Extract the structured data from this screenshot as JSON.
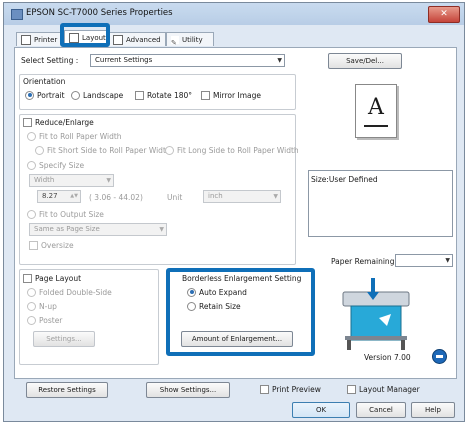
{
  "window": {
    "title": "EPSON SC-T7000 Series Properties",
    "close": "✕"
  },
  "tabs": [
    {
      "label": "Printer Setting"
    },
    {
      "label": "Layout"
    },
    {
      "label": "Advanced"
    },
    {
      "label": "Utility"
    }
  ],
  "select_setting": {
    "label": "Select Setting :",
    "value": "Current Settings",
    "save_del": "Save/Del..."
  },
  "orientation": {
    "label": "Orientation",
    "portrait": "Portrait",
    "landscape": "Landscape",
    "rotate": "Rotate 180°",
    "mirror": "Mirror Image"
  },
  "reduce": {
    "label": "Reduce/Enlarge",
    "fit_roll_width": "Fit to Roll Paper Width",
    "fit_short": "Fit Short Side to Roll Paper Width",
    "fit_long": "Fit Long Side to Roll Paper Width",
    "specify_size": "Specify Size",
    "width_option": "Width",
    "width_value": "8.27",
    "range": "( 3.06 - 44.02)",
    "unit_label": "Unit",
    "unit_value": "inch",
    "fit_output": "Fit to Output Size",
    "output_value": "Same as Page Size",
    "oversize": "Oversize"
  },
  "page_layout": {
    "label": "Page Layout",
    "folded": "Folded Double-Side",
    "nup": "N-up",
    "poster": "Poster",
    "settings_btn": "Settings..."
  },
  "borderless": {
    "title": "Borderless Enlargement Setting",
    "auto_expand": "Auto Expand",
    "retain_size": "Retain Size",
    "amount_btn": "Amount of Enlargement..."
  },
  "preview": {
    "letter": "A",
    "size_text": "Size:User Defined",
    "paper_remaining": "Paper Remaining:",
    "version": "Version 7.00"
  },
  "bottom": {
    "restore": "Restore Settings",
    "show": "Show Settings...",
    "print_preview": "Print Preview",
    "layout_manager": "Layout Manager"
  },
  "dialog": {
    "ok": "OK",
    "cancel": "Cancel",
    "help": "Help"
  },
  "colors": {
    "highlight": "#0f6fb8"
  }
}
